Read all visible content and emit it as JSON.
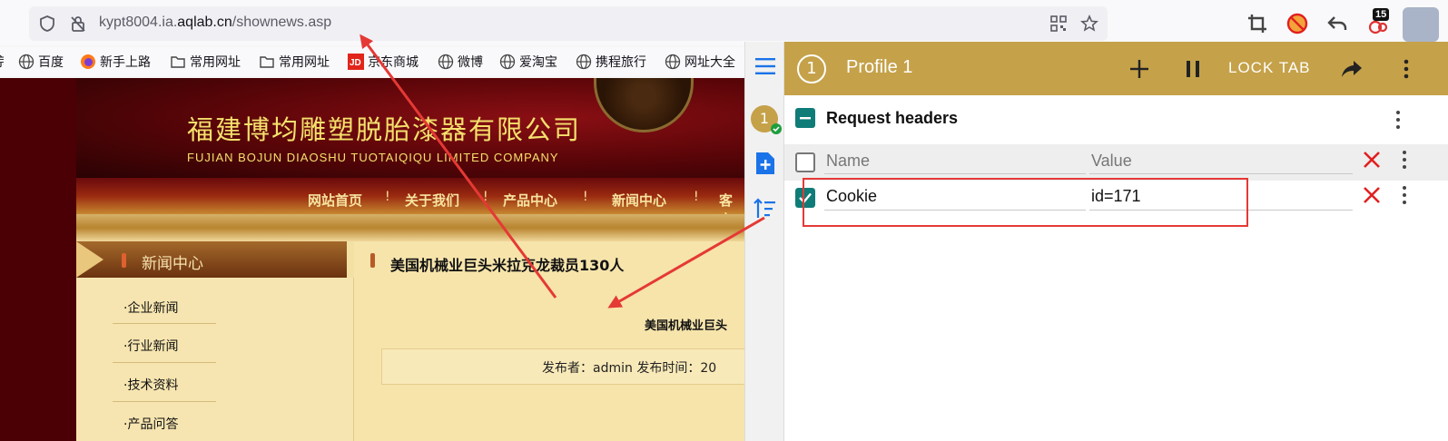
{
  "browser": {
    "url_prefix": "kypt8004.ia.",
    "url_domain": "aqlab.cn",
    "url_path": "/shownews.asp",
    "badge_count": "15"
  },
  "bookmarks": [
    {
      "label": "百度"
    },
    {
      "label": "新手上路"
    },
    {
      "label": "常用网址"
    },
    {
      "label": "常用网址"
    },
    {
      "label": "京东商城"
    },
    {
      "label": "微博"
    },
    {
      "label": "爱淘宝"
    },
    {
      "label": "携程旅行"
    },
    {
      "label": "网址大全"
    }
  ],
  "website": {
    "company_cn": "福建博均雕塑脱胎漆器有限公司",
    "company_en": "FUJIAN BOJUN DIAOSHU  TUOTAIQIQU  LIMITED COMPANY",
    "nav": [
      "网站首页",
      "关于我们",
      "产品中心",
      "新闻中心",
      "客户"
    ],
    "nav_sep": "!",
    "sidebar_heading": "新闻中心",
    "sidebar_items": [
      "·企业新闻",
      "·行业新闻",
      "·技术资料",
      "·产品问答"
    ],
    "news_title": "美国机械业巨头米拉克龙裁员130人",
    "news_subtitle": "美国机械业巨头",
    "meta": "发布者：admin 发布时间：20"
  },
  "extension": {
    "profile_number": "1",
    "profile_name": "Profile 1",
    "lock_tab": "LOCK TAB",
    "section_title": "Request headers",
    "columns": {
      "name": "Name",
      "value": "Value"
    },
    "rows": [
      {
        "name": "Cookie",
        "value": "id=171",
        "checked": true
      }
    ],
    "sidebar_profile_number": "1"
  },
  "colors": {
    "accent": "#c5a149",
    "teal": "#0f7c78",
    "annotation_red": "#e53935",
    "delete_red": "#e21f1f"
  }
}
